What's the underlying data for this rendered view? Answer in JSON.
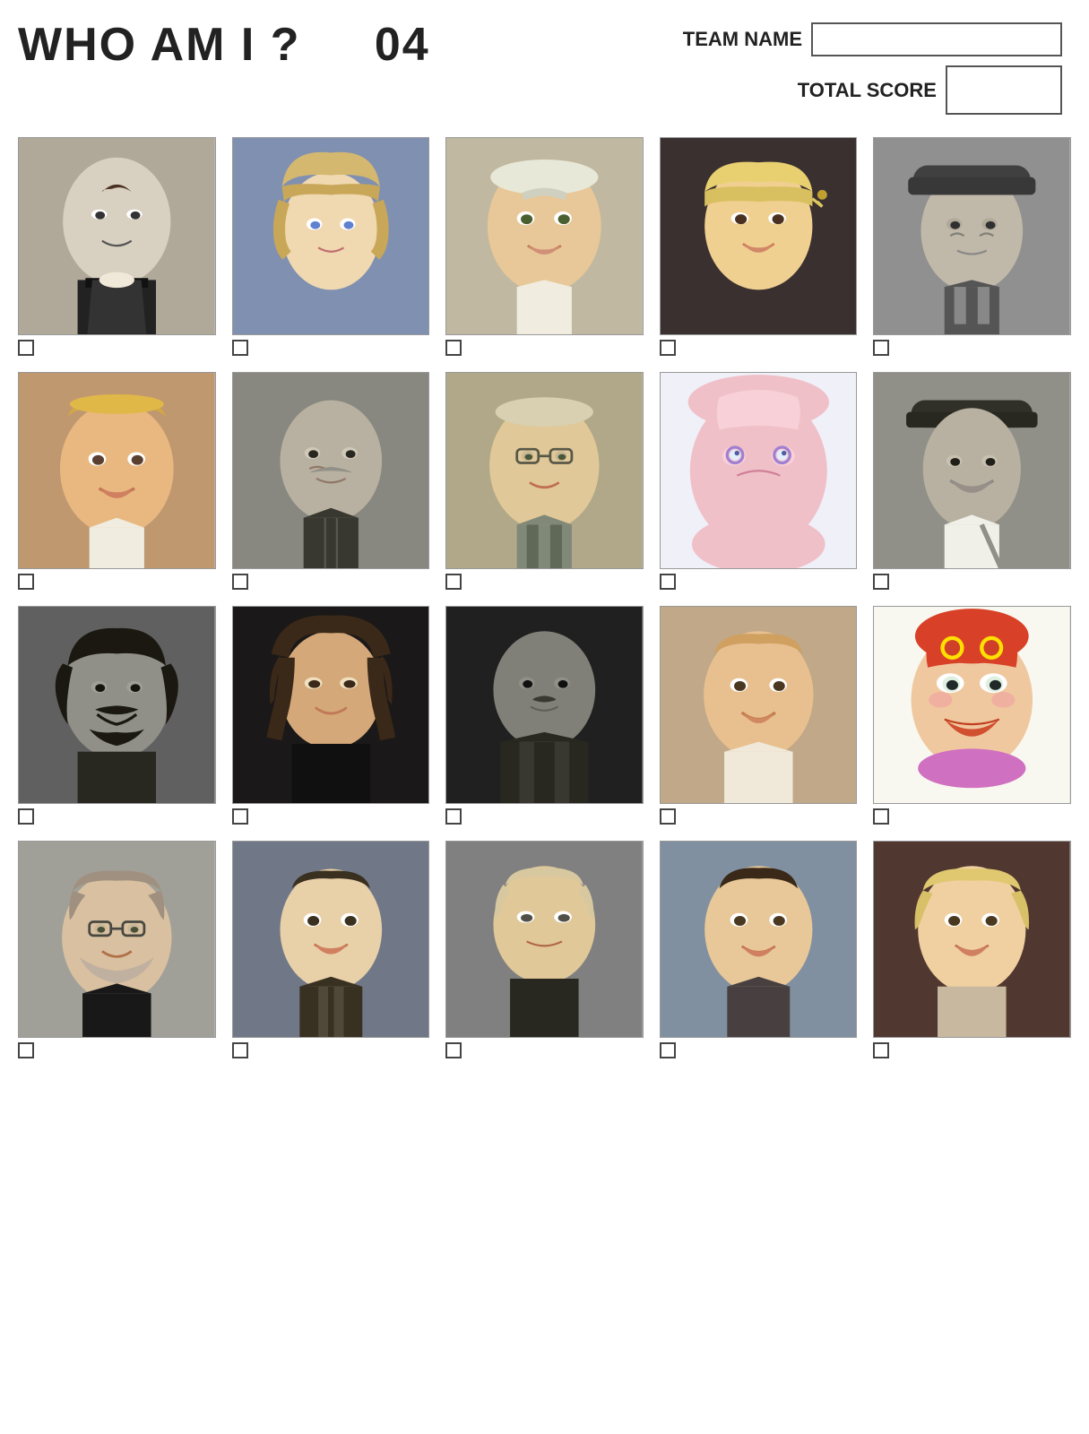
{
  "header": {
    "title": "WHO AM I ?",
    "subtitle": "04",
    "team_name_label": "TEAM NAME",
    "total_score_label": "TOTAL SCORE",
    "team_name_placeholder": "",
    "total_score_placeholder": ""
  },
  "grid": {
    "rows": [
      [
        {
          "id": 1,
          "description": "Young man in tuxedo, black and white",
          "bw": true
        },
        {
          "id": 2,
          "description": "Young blonde girl, blue top",
          "bw": false
        },
        {
          "id": 3,
          "description": "Older man smiling, white shirt",
          "bw": false
        },
        {
          "id": 4,
          "description": "Blonde woman with hair clip",
          "bw": false
        },
        {
          "id": 5,
          "description": "Man in fedora hat, black and white",
          "bw": true
        }
      ],
      [
        {
          "id": 6,
          "description": "Older man with blonde hair smirking",
          "bw": false
        },
        {
          "id": 7,
          "description": "Man with mustache, black and white",
          "bw": true
        },
        {
          "id": 8,
          "description": "Older man with glasses and tie",
          "bw": false
        },
        {
          "id": 9,
          "description": "Pink fluffy puppet character",
          "bw": false
        },
        {
          "id": 10,
          "description": "Man in hat with cane, black and white",
          "bw": true
        }
      ],
      [
        {
          "id": 11,
          "description": "Man with dark curly hair and beard, black and white",
          "bw": true
        },
        {
          "id": 12,
          "description": "Woman with long brown hair",
          "bw": false
        },
        {
          "id": 13,
          "description": "Man in dark jacket, action pose",
          "bw": false
        },
        {
          "id": 14,
          "description": "Man smiling, close up",
          "bw": false
        },
        {
          "id": 15,
          "description": "Krusty the Clown cartoon character",
          "bw": false
        }
      ],
      [
        {
          "id": 16,
          "description": "Older man with glasses, beard",
          "bw": false
        },
        {
          "id": 17,
          "description": "Young man in suit smiling",
          "bw": false
        },
        {
          "id": 18,
          "description": "Blonde woman serious expression",
          "bw": false
        },
        {
          "id": 19,
          "description": "Young man close up",
          "bw": false
        },
        {
          "id": 20,
          "description": "Blonde woman glamorous",
          "bw": false
        }
      ]
    ]
  }
}
